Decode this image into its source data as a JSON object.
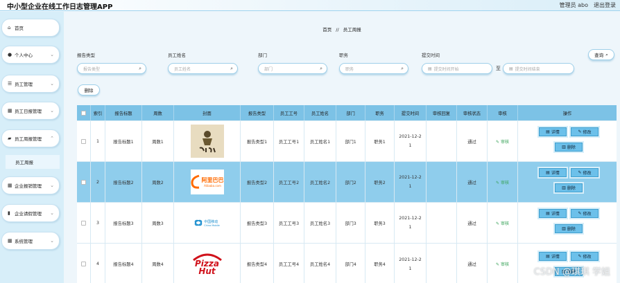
{
  "app": {
    "title": "中小型企业在线工作日志管理APP"
  },
  "header": {
    "user_label": "管理员 abo",
    "logout_label": "退出登录"
  },
  "sidebar": {
    "items": [
      {
        "label": "首页",
        "icon": "home-icon"
      },
      {
        "label": "个人中心",
        "icon": "user-icon"
      },
      {
        "label": "员工管理",
        "icon": "sliders-icon"
      },
      {
        "label": "员工日报管理",
        "icon": "grid-icon"
      },
      {
        "label": "员工周报管理",
        "icon": "briefcase-icon"
      },
      {
        "label": "企业报销管理",
        "icon": "grid-icon"
      },
      {
        "label": "企业请假管理",
        "icon": "bar-chart-icon"
      },
      {
        "label": "系统管理",
        "icon": "grid-icon"
      }
    ],
    "sub_item": {
      "label": "员工周报"
    }
  },
  "breadcrumb": {
    "home": "首页",
    "separator": "//",
    "current": "员工周报"
  },
  "filters": {
    "report_type": {
      "label": "报告类型",
      "placeholder": "报告类型"
    },
    "employee_name": {
      "label": "员工姓名",
      "placeholder": "员工姓名"
    },
    "department": {
      "label": "部门",
      "placeholder": "部门"
    },
    "position": {
      "label": "职务",
      "placeholder": "职务"
    },
    "submit_time": {
      "label": "提交时间",
      "start_placeholder": "提交时间开始",
      "separator": "至",
      "end_placeholder": "提交时间结束"
    },
    "search_button": "查询",
    "delete_button": "删除"
  },
  "table": {
    "columns": [
      "索引",
      "报告标题",
      "周数",
      "封面",
      "报告类型",
      "员工工号",
      "员工姓名",
      "部门",
      "职务",
      "提交时间",
      "审核回复",
      "审核状态",
      "审核",
      "操作"
    ],
    "rows": [
      {
        "index": "1",
        "title": "报告标题1",
        "week": "周数1",
        "cover": "pizza-store-logo",
        "type": "报告类型1",
        "emp_no": "员工工号1",
        "emp_name": "员工姓名1",
        "dept": "部门1",
        "position": "职务1",
        "time_line1": "2021-12-2",
        "time_line2": "1",
        "reply": "",
        "status": "通过",
        "audit": "审核"
      },
      {
        "index": "2",
        "title": "报告标题2",
        "week": "周数2",
        "cover": "alibaba-logo",
        "type": "报告类型2",
        "emp_no": "员工工号2",
        "emp_name": "员工姓名2",
        "dept": "部门2",
        "position": "职务2",
        "time_line1": "2021-12-2",
        "time_line2": "1",
        "reply": "",
        "status": "通过",
        "audit": "审核"
      },
      {
        "index": "3",
        "title": "报告标题3",
        "week": "周数3",
        "cover": "china-mobile-logo",
        "type": "报告类型3",
        "emp_no": "员工工号3",
        "emp_name": "员工姓名3",
        "dept": "部门3",
        "position": "职务3",
        "time_line1": "2021-12-2",
        "time_line2": "1",
        "reply": "",
        "status": "通过",
        "audit": "审核"
      },
      {
        "index": "4",
        "title": "报告标题4",
        "week": "周数4",
        "cover": "pizza-hut-logo",
        "type": "报告类型4",
        "emp_no": "员工工号4",
        "emp_name": "员工姓名4",
        "dept": "部门4",
        "position": "职务4",
        "time_line1": "2021-12-2",
        "time_line2": "1",
        "reply": "",
        "status": "通过",
        "audit": "审核"
      }
    ],
    "actions": {
      "detail": "详情",
      "edit": "修改",
      "delete": "删除"
    }
  },
  "logos": {
    "alibaba_text": "阿里巴巴",
    "alibaba_domain": "Alibaba.com",
    "china_mobile_text": "中国移动",
    "china_mobile_en": "China Mobile",
    "pizza_hut_line1": "Pizza",
    "pizza_hut_line2": "Hut"
  },
  "watermark": "CSDN @琪琪 学姐",
  "colors": {
    "header_row": "#7cc2e6",
    "selected_row": "#8fcdec",
    "action_button": "#6cc0ea",
    "audit_link": "#3aa35a",
    "sidebar_bg": "#d7eef9"
  }
}
